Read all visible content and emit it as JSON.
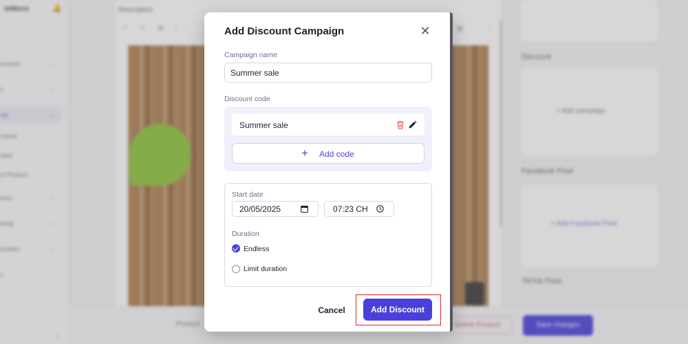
{
  "background": {
    "sidebar": {
      "brand": "teMore",
      "items": [
        "",
        "nmerce",
        "s",
        "uct",
        "roduct",
        "ction",
        "st Product",
        "tees",
        "eting",
        "tunities",
        "s"
      ],
      "chevrons": [
        "⌄",
        "⌄",
        "⌄",
        "⌄",
        "⌄",
        "⌄"
      ]
    },
    "editor": {
      "label": "Description"
    },
    "right_panel": {
      "discount_label": "Discount",
      "add_campaign": "Add campaign",
      "facebook_label": "Facebook Pixel",
      "add_facebook": "+ Add Facebook Pixel",
      "tiktok_label": "TikTok Pixel"
    },
    "footer": {
      "product_text": "Product",
      "delete_label": "Delete Product",
      "save_label": "Save changes"
    }
  },
  "modal": {
    "title": "Add Discount Campaign",
    "close_icon": "close-icon",
    "campaign_name": {
      "label": "Campaign name",
      "value": "Summer sale"
    },
    "discount_code": {
      "label": "Discount code",
      "codes": [
        "Summer sale"
      ],
      "add_code_label": "Add code"
    },
    "start_date": {
      "label": "Start date",
      "date_value": "20/05/2025",
      "time_value": "07:23 CH"
    },
    "duration": {
      "label": "Duration",
      "options": [
        {
          "label": "Endless",
          "selected": true
        },
        {
          "label": "Limit duration",
          "selected": false
        }
      ]
    },
    "buttons": {
      "cancel": "Cancel",
      "add_discount": "Add Discount"
    },
    "accent_color": "#4b3fdc",
    "highlight_color": "#e0241f"
  }
}
